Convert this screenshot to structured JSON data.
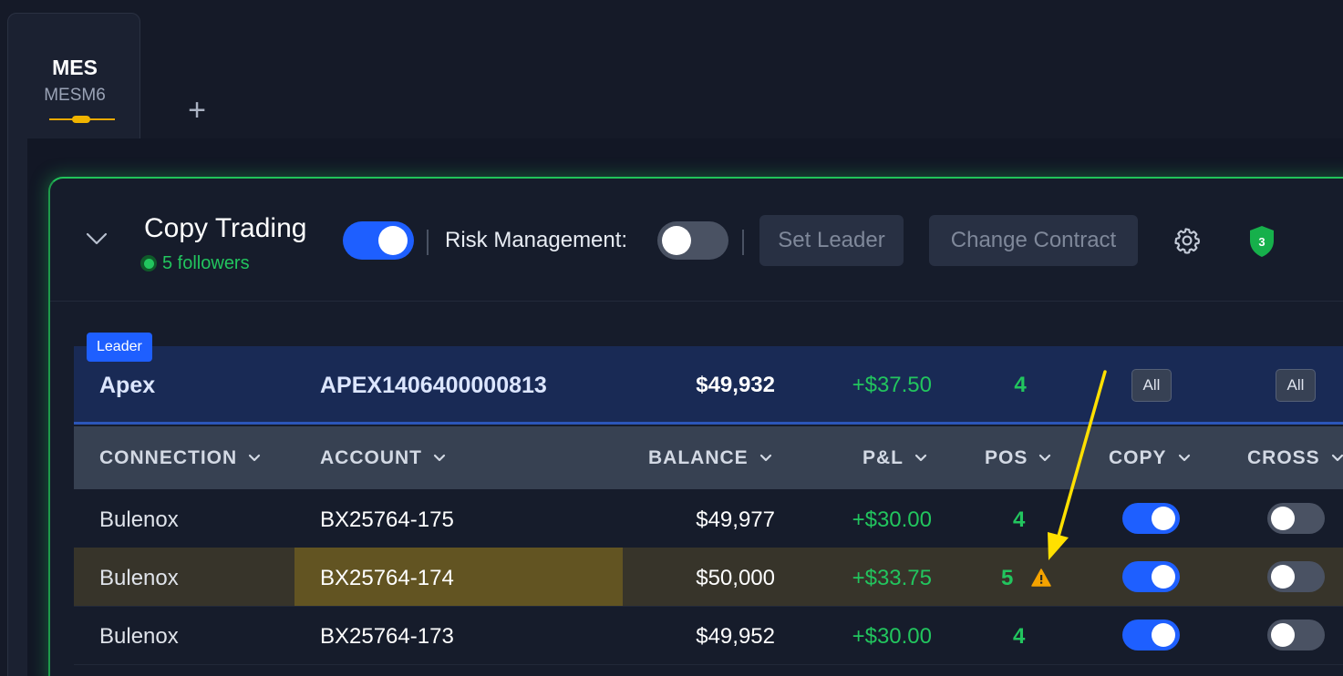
{
  "tabs": [
    {
      "symbol": "MES",
      "contract": "MESM6"
    }
  ],
  "add_tab_glyph": "+",
  "panel": {
    "title": "Copy Trading",
    "followers": "5 followers",
    "copy_enabled": true,
    "risk_label": "Risk Management:",
    "risk_enabled": false,
    "separator": "|",
    "set_leader_label": "Set Leader",
    "change_contract_label": "Change Contract",
    "shield_count": "3"
  },
  "table": {
    "leader_badge": "Leader",
    "leader": {
      "connection": "Apex",
      "account": "APEX1406400000813",
      "balance": "$49,932",
      "pnl": "+$37.50",
      "pos": "4",
      "copy_all": "All",
      "cross_all": "All"
    },
    "headers": {
      "connection": "CONNECTION",
      "account": "ACCOUNT",
      "balance": "BALANCE",
      "pnl": "P&L",
      "pos": "POS",
      "copy": "COPY",
      "cross": "CROSS"
    },
    "rows": [
      {
        "connection": "Bulenox",
        "account": "BX25764-175",
        "balance": "$49,977",
        "pnl": "+$30.00",
        "pos": "4",
        "copy": true,
        "cross": false,
        "warning": false
      },
      {
        "connection": "Bulenox",
        "account": "BX25764-174",
        "balance": "$50,000",
        "pnl": "+$33.75",
        "pos": "5",
        "copy": true,
        "cross": false,
        "warning": true
      },
      {
        "connection": "Bulenox",
        "account": "BX25764-173",
        "balance": "$49,952",
        "pnl": "+$30.00",
        "pos": "4",
        "copy": true,
        "cross": false,
        "warning": false
      }
    ]
  },
  "colors": {
    "accent_blue": "#1e5fff",
    "positive_green": "#22c55e",
    "warning_amber": "#f5a300",
    "annotation_yellow": "#ffe000"
  },
  "icons": {
    "collapse": "chevron-down-icon",
    "settings": "gear-icon",
    "shield": "shield-icon",
    "warning": "warning-icon",
    "sort": "chevron-down-icon"
  }
}
